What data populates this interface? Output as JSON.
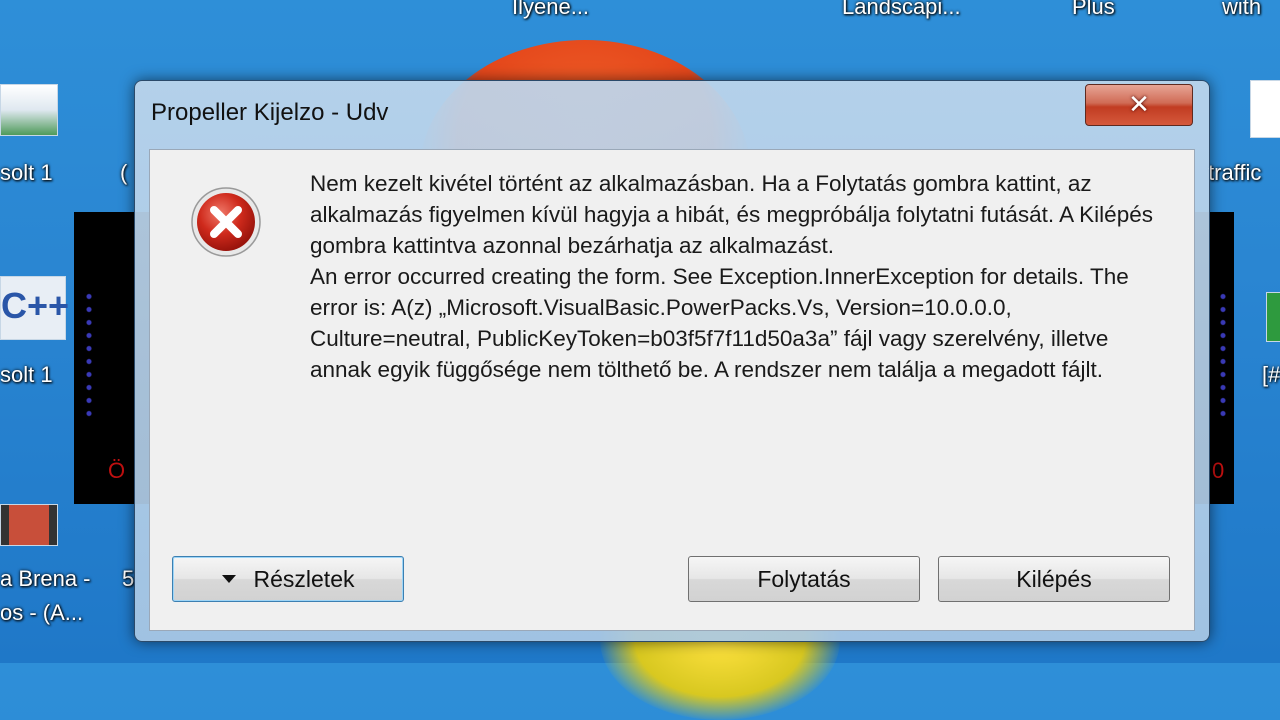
{
  "desktop": {
    "top_labels": [
      "Ilyene...",
      "Landscapi...",
      "Plus",
      "with"
    ],
    "left_labels": [
      "solt 1",
      "solt 1",
      "a Brena -",
      "os - (A..."
    ],
    "left_label_partials": [
      "(",
      "5"
    ],
    "right_labels": [
      "traffic",
      "[#"
    ],
    "icon_text": "C++",
    "bg_window_text": [
      "Ö",
      "0"
    ]
  },
  "dialog": {
    "title": "Propeller Kijelzo - Udv",
    "close_label": "✕",
    "icon": "error-icon",
    "message_hu": "Nem kezelt kivétel történt az alkalmazásban. Ha a Folytatás gombra kattint, az alkalmazás figyelmen kívül hagyja a hibát, és megpróbálja folytatni futását. A Kilépés gombra kattintva azonnal bezárhatja az alkalmazást.",
    "message_en": "An error occurred creating the form. See Exception.InnerException for details.  The error is: A(z) „Microsoft.VisualBasic.PowerPacks.Vs, Version=10.0.0.0, Culture=neutral, PublicKeyToken=b03f5f7f11d50a3a” fájl vagy szerelvény, illetve annak egyik függősége nem tölthető be. A rendszer nem találja a megadott fájlt.",
    "buttons": {
      "details": "Részletek",
      "continue": "Folytatás",
      "quit": "Kilépés"
    }
  }
}
